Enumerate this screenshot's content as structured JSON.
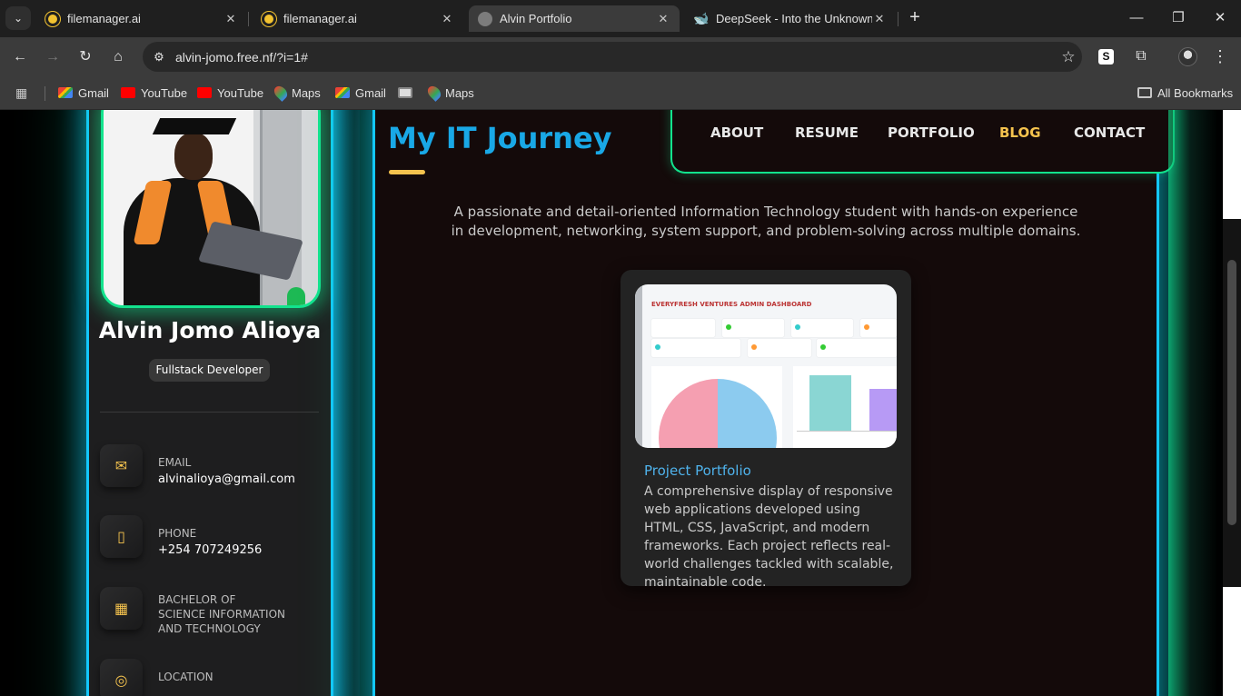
{
  "browser": {
    "tabs": [
      {
        "title": "filemanager.ai",
        "active": false
      },
      {
        "title": "filemanager.ai",
        "active": false
      },
      {
        "title": "Alvin Portfolio",
        "active": true
      },
      {
        "title": "DeepSeek - Into the Unknown",
        "active": false
      }
    ],
    "url": "alvin-jomo.free.nf/?i=1#",
    "bookmarks": [
      "Gmail",
      "YouTube",
      "YouTube",
      "Maps",
      "Gmail",
      "Maps"
    ],
    "all_bookmarks": "All Bookmarks"
  },
  "sidebar": {
    "name": "Alvin Jomo Alioya",
    "role": "Fullstack Developer",
    "contacts": [
      {
        "label": "EMAIL",
        "value": "alvinalioya@gmail.com",
        "icon": "mail-icon"
      },
      {
        "label": "PHONE",
        "value": "+254 707249256",
        "icon": "phone-icon"
      },
      {
        "label": "BACHELOR OF SCIENCE INFORMATION AND TECHNOLOGY",
        "value": "",
        "icon": "calendar-icon"
      },
      {
        "label": "LOCATION",
        "value": "",
        "icon": "location-icon"
      }
    ]
  },
  "main": {
    "title": "My IT Journey",
    "nav": [
      "ABOUT",
      "RESUME",
      "PORTFOLIO",
      "BLOG",
      "CONTACT"
    ],
    "active_nav": "BLOG",
    "intro": "A passionate and detail-oriented Information Technology student with hands-on experience in development, networking, system support, and problem-solving across multiple domains.",
    "card": {
      "screenshot_heading": "EVERYFRESH VENTURES ADMIN DASHBOARD",
      "title": "Project Portfolio",
      "description": "A comprehensive display of responsive web applications developed using HTML, CSS, JavaScript, and modern frameworks. Each project reflects real-world challenges tackled with scalable, maintainable code."
    }
  },
  "colors": {
    "accent_blue": "#19a8e6",
    "accent_green": "#12e38d",
    "accent_yellow": "#f5c34e",
    "glow_cyan": "#13c7ff"
  }
}
